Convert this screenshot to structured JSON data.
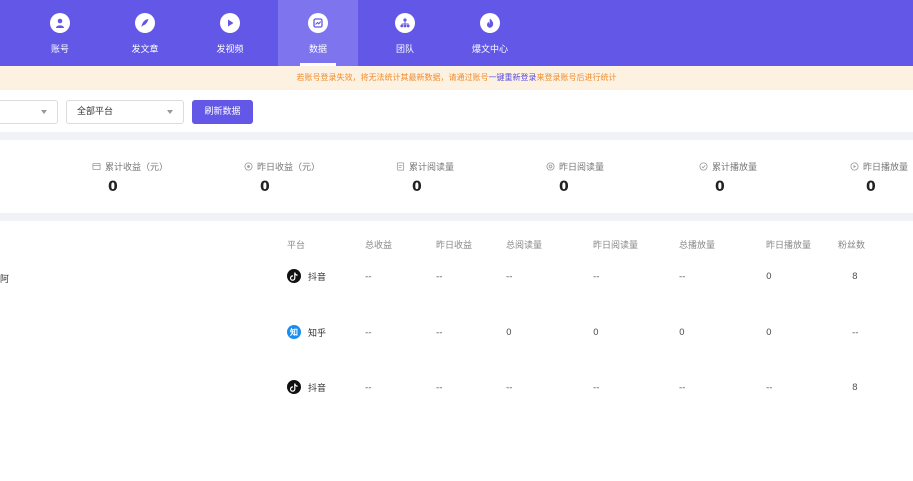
{
  "nav": {
    "items": [
      {
        "label": "账号",
        "icon": "user-icon"
      },
      {
        "label": "发文章",
        "icon": "feather-icon"
      },
      {
        "label": "发视频",
        "icon": "play-icon"
      },
      {
        "label": "数据",
        "icon": "chart-icon"
      },
      {
        "label": "团队",
        "icon": "team-icon"
      },
      {
        "label": "爆文中心",
        "icon": "fire-icon"
      }
    ],
    "active_index": 3
  },
  "warning": {
    "text_before": "若账号登录失效，将无法统计其最新数据，请通过账号",
    "link1": "一键重新登录",
    "link2": "来登录账号后进行统计",
    "color": "#f08d2b"
  },
  "filters": {
    "select2_value": "全部平台",
    "refresh_label": "刷新数据"
  },
  "stats": [
    {
      "label": "累计收益（元）",
      "value": "0",
      "icon": "wallet-icon"
    },
    {
      "label": "昨日收益（元）",
      "value": "0",
      "icon": "coin-icon"
    },
    {
      "label": "累计阅读量",
      "value": "0",
      "icon": "doc-icon"
    },
    {
      "label": "昨日阅读量",
      "value": "0",
      "icon": "eye-icon"
    },
    {
      "label": "累计播放量",
      "value": "0",
      "icon": "play-circle-icon"
    },
    {
      "label": "昨日播放量",
      "value": "0",
      "icon": "play-circle-icon"
    }
  ],
  "table": {
    "headers": [
      "平台",
      "总收益",
      "昨日收益",
      "总阅读量",
      "昨日阅读量",
      "总播放量",
      "昨日播放量",
      "粉丝数"
    ],
    "rows": [
      {
        "account": "阿",
        "platform": "抖音",
        "platform_icon": "douyin-icon",
        "cells": [
          "--",
          "--",
          "--",
          "--",
          "--",
          "0",
          "8"
        ]
      },
      {
        "account": "",
        "platform": "知乎",
        "platform_icon": "zhihu-icon",
        "platform_icon_text": "知",
        "cells": [
          "--",
          "--",
          "0",
          "0",
          "0",
          "0",
          "--"
        ]
      },
      {
        "account": "",
        "platform": "抖音",
        "platform_icon": "douyin-icon",
        "cells": [
          "--",
          "--",
          "--",
          "--",
          "--",
          "--",
          "8"
        ]
      }
    ]
  },
  "colors": {
    "brand": "#6257e6",
    "warning_bg": "#fdf1e2",
    "link": "#5a4de0"
  }
}
